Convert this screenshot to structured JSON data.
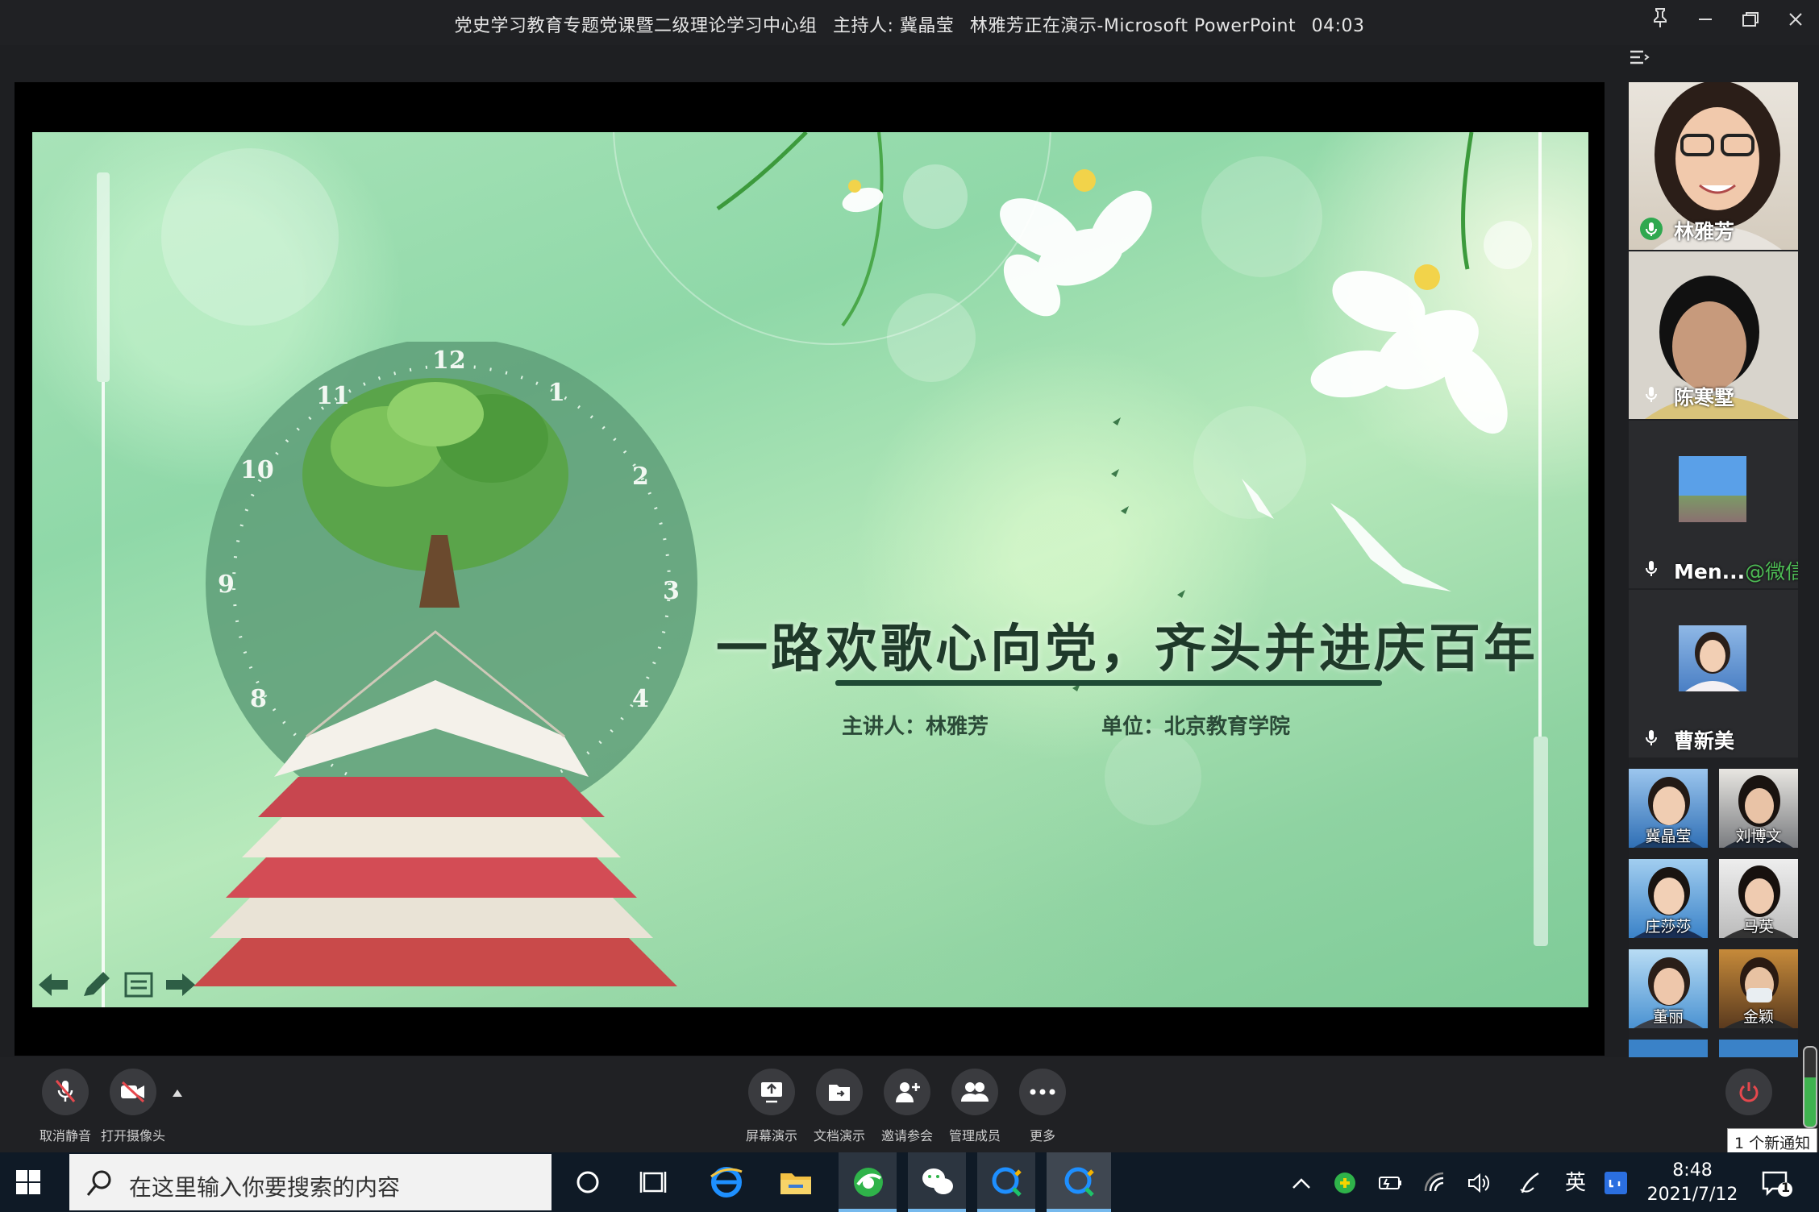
{
  "window": {
    "title": "党史学习教育专题党课暨二级理论学习中心组",
    "host": "主持人: 冀晶莹",
    "presenting": "林雅芳正在演示-Microsoft PowerPoint",
    "timer": "04:03"
  },
  "slide": {
    "title": "一路欢歌心向党，齐头并进庆百年",
    "speaker": "主讲人：林雅芳",
    "unit": "单位：北京教育学院",
    "clock_numbers": [
      "12",
      "1",
      "2",
      "3",
      "4",
      "8",
      "9",
      "10",
      "11"
    ]
  },
  "participants": {
    "large": [
      {
        "name": "林雅芳",
        "speaking": true
      },
      {
        "name": "陈寒墅",
        "speaking": false
      },
      {
        "name": "Men...",
        "suffix": "@微信",
        "speaking": false
      },
      {
        "name": "曹新美",
        "speaking": false
      }
    ],
    "thumbs": [
      "冀晶莹",
      "刘博文",
      "庄莎莎",
      "马英",
      "董丽",
      "金颖"
    ]
  },
  "controls": {
    "left": [
      "取消静音",
      "打开摄像头"
    ],
    "center": [
      "屏幕演示",
      "文档演示",
      "邀请参会",
      "管理成员",
      "更多"
    ],
    "leave": "结束",
    "notification": "1 个新通知"
  },
  "taskbar": {
    "search_placeholder": "在这里输入你要搜索的内容",
    "ime": "英",
    "time": "8:48",
    "date": "2021/7/12",
    "notif_count": "1"
  },
  "colors": {
    "accent": "#76b9ed",
    "leave_red": "#e5484d",
    "wechat_green": "#4dbb54",
    "slide_title": "#1f3a2a"
  }
}
